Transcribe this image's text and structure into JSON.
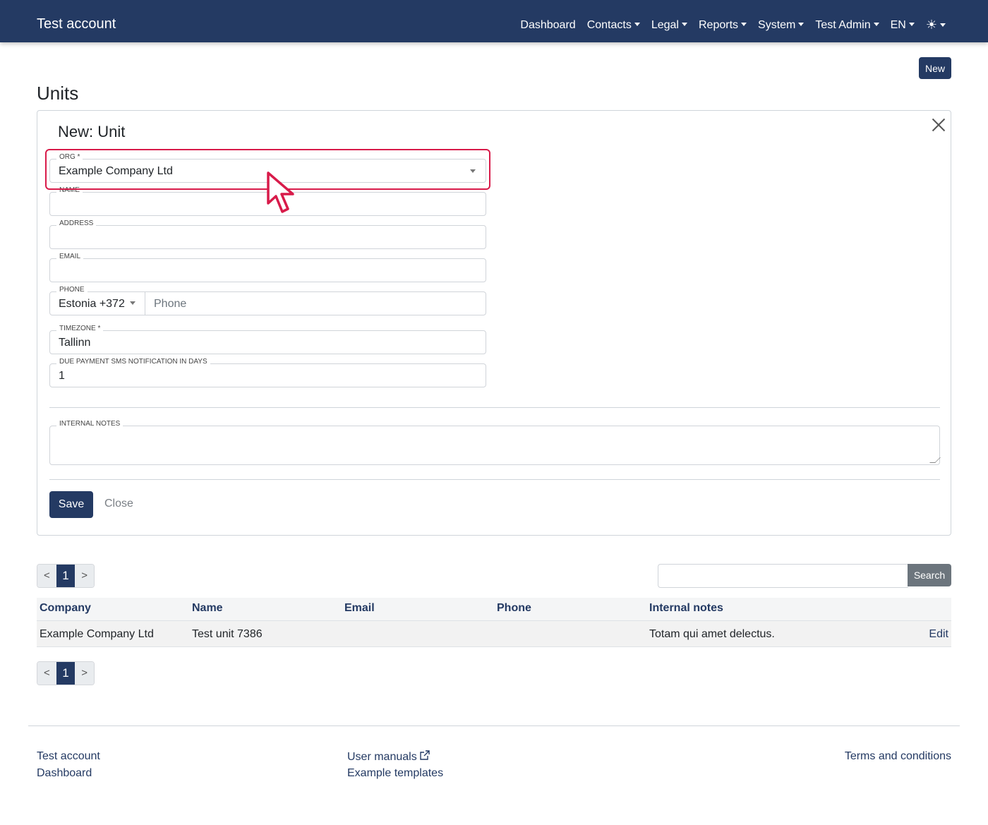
{
  "navbar": {
    "brand": "Test account",
    "items": [
      {
        "label": "Dashboard",
        "dropdown": false
      },
      {
        "label": "Contacts",
        "dropdown": true
      },
      {
        "label": "Legal",
        "dropdown": true
      },
      {
        "label": "Reports",
        "dropdown": true
      },
      {
        "label": "System",
        "dropdown": true
      },
      {
        "label": "Test Admin",
        "dropdown": true
      },
      {
        "label": "EN",
        "dropdown": true
      }
    ],
    "theme_icon": "☀"
  },
  "page": {
    "new_label": "New",
    "title": "Units"
  },
  "form": {
    "title": "New: Unit",
    "org": {
      "label": "ORG *",
      "value": "Example Company Ltd"
    },
    "name": {
      "label": "NAME",
      "value": ""
    },
    "address": {
      "label": "ADDRESS",
      "value": ""
    },
    "email": {
      "label": "EMAIL",
      "value": ""
    },
    "phone": {
      "label": "PHONE",
      "country": "Estonia +372",
      "placeholder": "Phone"
    },
    "timezone": {
      "label": "TIMEZONE *",
      "value": "Tallinn"
    },
    "due_payment": {
      "label": "DUE PAYMENT SMS NOTIFICATION IN DAYS",
      "value": "1"
    },
    "internal_notes": {
      "label": "INTERNAL NOTES",
      "value": ""
    },
    "save_label": "Save",
    "close_label": "Close"
  },
  "pagination": {
    "prev": "<",
    "current": "1",
    "next": ">"
  },
  "search": {
    "button": "Search",
    "value": ""
  },
  "table": {
    "columns": [
      "Company",
      "Name",
      "Email",
      "Phone",
      "Internal notes"
    ],
    "rows": [
      {
        "company": "Example Company Ltd",
        "name": "Test unit 7386",
        "email": "",
        "phone": "",
        "notes": "Totam qui amet delectus.",
        "action": "Edit"
      }
    ]
  },
  "footer": {
    "col1": [
      "Test account",
      "Dashboard"
    ],
    "col2": [
      "User manuals",
      "Example templates"
    ],
    "col3": [
      "Terms and conditions"
    ]
  },
  "colors": {
    "primary": "#243a63",
    "highlight": "#d81b4a",
    "secondary": "#6c757d"
  }
}
